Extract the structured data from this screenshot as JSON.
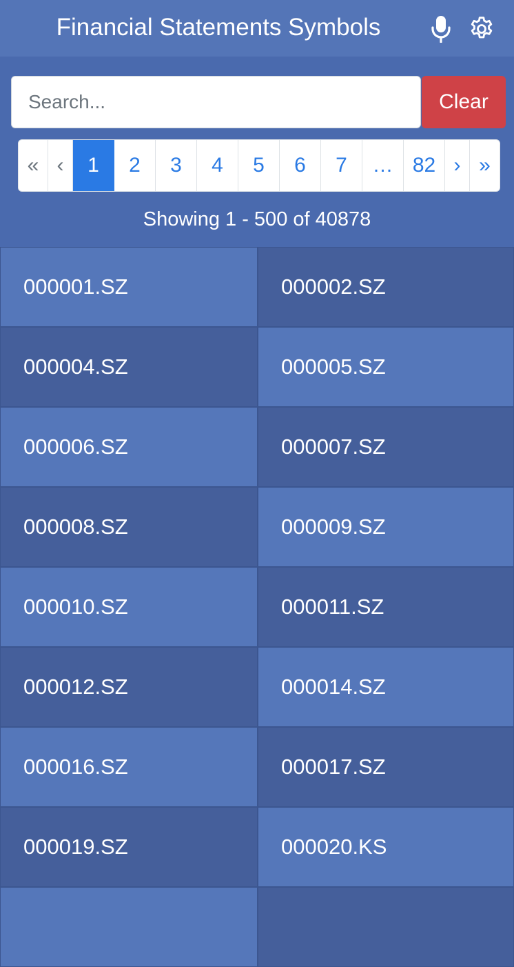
{
  "header": {
    "title": "Financial Statements Symbols",
    "mic_icon": "microphone-icon",
    "settings_icon": "gear-icon"
  },
  "search": {
    "placeholder": "Search...",
    "value": "",
    "clear_label": "Clear"
  },
  "pagination": {
    "first": "«",
    "prev": "‹",
    "pages": [
      "1",
      "2",
      "3",
      "4",
      "5",
      "6",
      "7"
    ],
    "ellipsis": "…",
    "last_page": "82",
    "next": "›",
    "last": "»",
    "active_page": "1"
  },
  "status": {
    "showing": "Showing 1 - 500 of 40878"
  },
  "symbols": [
    "000001.SZ",
    "000002.SZ",
    "000004.SZ",
    "000005.SZ",
    "000006.SZ",
    "000007.SZ",
    "000008.SZ",
    "000009.SZ",
    "000010.SZ",
    "000011.SZ",
    "000012.SZ",
    "000014.SZ",
    "000016.SZ",
    "000017.SZ",
    "000019.SZ",
    "000020.KS",
    "",
    ""
  ],
  "colors": {
    "page_bg": "#4a6aae",
    "header_bg": "#5475b7",
    "cell_light": "#5577ba",
    "cell_dark": "#455f9b",
    "clear_button": "#cf4247",
    "active_page": "#2a7ae4"
  }
}
